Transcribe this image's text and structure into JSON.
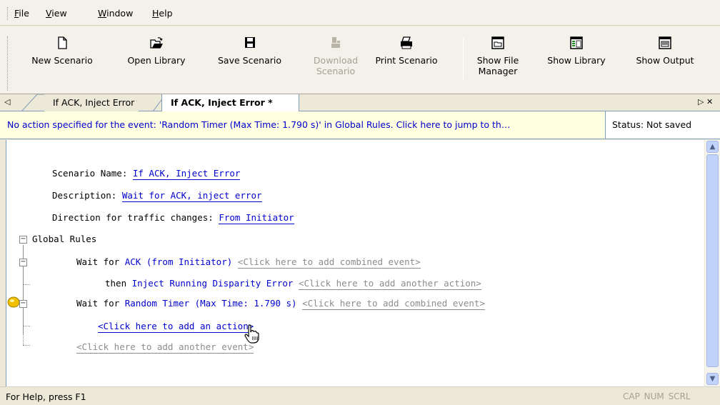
{
  "menu": {
    "items": [
      {
        "label": "File",
        "ul": "F",
        "rest": "ile"
      },
      {
        "label": "View",
        "ul": "V",
        "rest": "iew"
      },
      {
        "label": "Window",
        "ul": "W",
        "rest": "indow"
      },
      {
        "label": "Help",
        "ul": "H",
        "rest": "elp"
      }
    ]
  },
  "toolbar": {
    "new_scenario": "New Scenario",
    "open_library": "Open Library",
    "save_scenario": "Save Scenario",
    "download_line1": "Download",
    "download_line2": "Scenario",
    "print_scenario": "Print Scenario",
    "show_file_line1": "Show File",
    "show_file_line2": "Manager",
    "show_library": "Show Library",
    "show_output": "Show Output"
  },
  "tabs": {
    "left_arrow": "◁",
    "tab1": "If ACK, Inject Error",
    "tab2": "If ACK, Inject Error *",
    "right_controls": "▷ ✕"
  },
  "notification": {
    "message": "No action specified for the event: 'Random Timer (Max Time: 1.790 s)' in Global Rules.  Click here to jump to th…",
    "status": "Status: Not saved"
  },
  "scenario": {
    "name_label": "Scenario Name:",
    "name_value": "If ACK, Inject Error",
    "desc_label": "Description:",
    "desc_value": "Wait for ACK, inject error",
    "dir_label": "Direction for traffic changes:",
    "dir_value": "From Initiator"
  },
  "rules": {
    "global_label": "Global Rules",
    "rule1_wait": "Wait for",
    "rule1_event": "ACK (from Initiator)",
    "rule1_add": "<Click here to add combined event>",
    "rule1_then": "then",
    "rule1_action": "Inject Running Disparity Error",
    "rule1_add_action": "<Click here to add another action>",
    "rule2_wait": "Wait for",
    "rule2_event": "Random Timer (Max Time: 1.790 s)",
    "rule2_add": "<Click here to add combined event>",
    "rule2_add_action": "<Click here to add an action>",
    "add_event": "<Click here to add another event>"
  },
  "statusbar": {
    "help": "For Help, press F1",
    "indicators": "CAP NUM SCRL"
  },
  "colors": {
    "link": "#0000cc",
    "warning_bg": "#ffffe1",
    "warning_marker": "#f0c000"
  }
}
